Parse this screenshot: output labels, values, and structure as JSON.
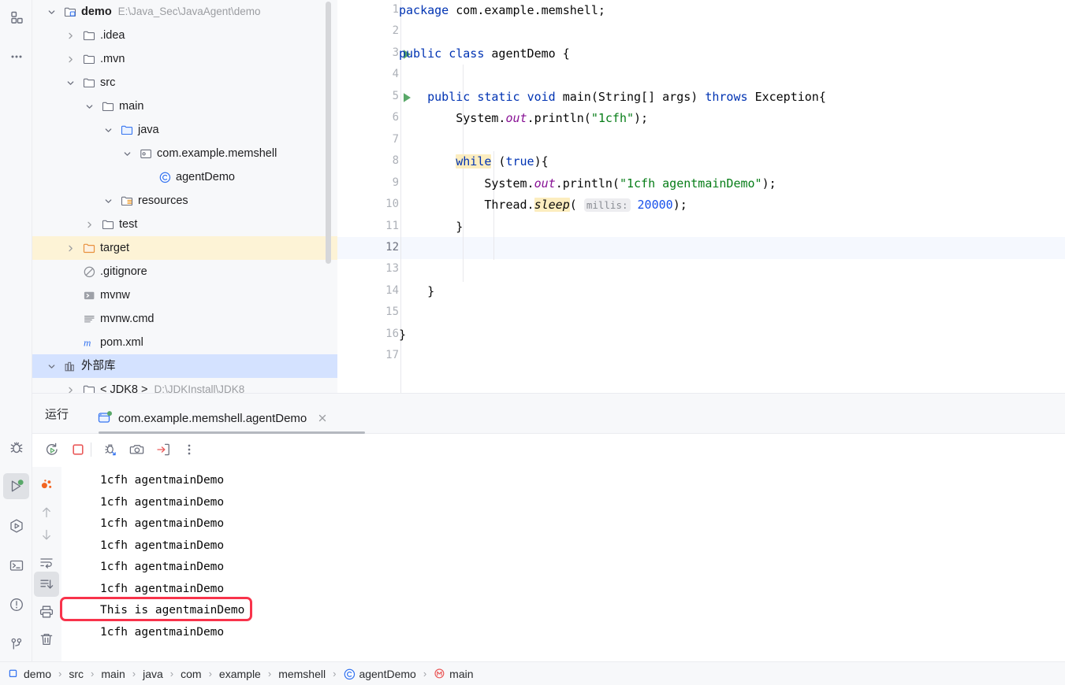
{
  "colors": {
    "accent_blue": "#0033b3",
    "string_green": "#067d17",
    "number_blue": "#1750eb",
    "field_purple": "#871094",
    "selection_blue": "#d4e2ff",
    "target_yellow": "#fdf3d6",
    "annotation_red": "#f8334b",
    "run_green": "#59a869",
    "stop_red": "#ea5b5b",
    "panel_grey": "#f7f8fa",
    "caret_row": "#f5f8fe"
  },
  "left_toolbar": {
    "top_items": [
      {
        "name": "project-icon",
        "label": "Project"
      },
      {
        "name": "more-icon",
        "label": "More tool windows"
      }
    ],
    "bottom_items": [
      {
        "name": "debug-icon",
        "label": "Debug",
        "selected": false
      },
      {
        "name": "run-icon",
        "label": "Run",
        "selected": true,
        "running": true
      },
      {
        "name": "services-icon",
        "label": "Services",
        "selected": false
      },
      {
        "name": "terminal-icon",
        "label": "Terminal",
        "selected": false
      },
      {
        "name": "problems-icon",
        "label": "Problems",
        "selected": false
      },
      {
        "name": "git-icon",
        "label": "Git",
        "selected": false
      }
    ]
  },
  "project_tree": {
    "rows": [
      {
        "label": "demo",
        "path": "E:\\Java_Sec\\JavaAgent\\demo",
        "icon": "module-folder-icon",
        "arrow": "down",
        "depth": 0,
        "bold": true,
        "highlight": "none"
      },
      {
        "label": ".idea",
        "path": "",
        "icon": "folder-icon",
        "arrow": "right",
        "depth": 1,
        "bold": false,
        "highlight": "none"
      },
      {
        "label": ".mvn",
        "path": "",
        "icon": "folder-icon",
        "arrow": "right",
        "depth": 1,
        "bold": false,
        "highlight": "none"
      },
      {
        "label": "src",
        "path": "",
        "icon": "folder-icon",
        "arrow": "down",
        "depth": 1,
        "bold": false,
        "highlight": "none"
      },
      {
        "label": "main",
        "path": "",
        "icon": "folder-icon",
        "arrow": "down",
        "depth": 2,
        "bold": false,
        "highlight": "none"
      },
      {
        "label": "java",
        "path": "",
        "icon": "source-folder-icon",
        "arrow": "down",
        "depth": 3,
        "bold": false,
        "highlight": "none"
      },
      {
        "label": "com.example.memshell",
        "path": "",
        "icon": "package-icon",
        "arrow": "down",
        "depth": 4,
        "bold": false,
        "highlight": "none"
      },
      {
        "label": "agentDemo",
        "path": "",
        "icon": "java-class-icon",
        "arrow": "none",
        "depth": 5,
        "bold": false,
        "highlight": "none"
      },
      {
        "label": "resources",
        "path": "",
        "icon": "resources-folder-icon",
        "arrow": "down",
        "depth": 3,
        "bold": false,
        "highlight": "none"
      },
      {
        "label": "test",
        "path": "",
        "icon": "folder-icon",
        "arrow": "right",
        "depth": 2,
        "bold": false,
        "highlight": "none"
      },
      {
        "label": "target",
        "path": "",
        "icon": "excluded-folder-icon",
        "arrow": "right",
        "depth": 1,
        "bold": false,
        "highlight": "target"
      },
      {
        "label": ".gitignore",
        "path": "",
        "icon": "gitignore-icon",
        "arrow": "none",
        "depth": 1,
        "bold": false,
        "highlight": "none"
      },
      {
        "label": "mvnw",
        "path": "",
        "icon": "shell-script-icon",
        "arrow": "none",
        "depth": 1,
        "bold": false,
        "highlight": "none"
      },
      {
        "label": "mvnw.cmd",
        "path": "",
        "icon": "text-file-icon",
        "arrow": "none",
        "depth": 1,
        "bold": false,
        "highlight": "none"
      },
      {
        "label": "pom.xml",
        "path": "",
        "icon": "maven-icon",
        "arrow": "none",
        "depth": 1,
        "bold": false,
        "highlight": "none"
      },
      {
        "label": "外部库",
        "path": "",
        "icon": "library-icon",
        "arrow": "down",
        "depth": 0,
        "bold": false,
        "highlight": "selected"
      },
      {
        "label": "< JDK8 >",
        "path": "D:\\JDKInstall\\JDK8",
        "icon": "folder-icon",
        "arrow": "right",
        "depth": 1,
        "bold": false,
        "highlight": "none"
      }
    ]
  },
  "editor": {
    "line_numbers": [
      1,
      2,
      3,
      4,
      5,
      6,
      7,
      8,
      9,
      10,
      11,
      12,
      13,
      14,
      15,
      16,
      17
    ],
    "run_marker_lines": [
      3,
      5
    ],
    "caret_line": 12,
    "lines": [
      {
        "n": 1,
        "text": "package com.example.memshell;"
      },
      {
        "n": 2,
        "text": ""
      },
      {
        "n": 3,
        "text": "public class agentDemo {"
      },
      {
        "n": 4,
        "text": ""
      },
      {
        "n": 5,
        "text": "    public static void main(String[] args) throws Exception{"
      },
      {
        "n": 6,
        "text": "        System.out.println(\"1cfh\");"
      },
      {
        "n": 7,
        "text": ""
      },
      {
        "n": 8,
        "text": "        while (true){"
      },
      {
        "n": 9,
        "text": "            System.out.println(\"1cfh agentmainDemo\");"
      },
      {
        "n": 10,
        "text": "            Thread.sleep( millis: 20000);"
      },
      {
        "n": 11,
        "text": "        }"
      },
      {
        "n": 12,
        "text": ""
      },
      {
        "n": 13,
        "text": ""
      },
      {
        "n": 14,
        "text": "    }"
      },
      {
        "n": 15,
        "text": ""
      },
      {
        "n": 16,
        "text": "}"
      },
      {
        "n": 17,
        "text": ""
      }
    ],
    "tokens": {
      "kw_package": "package",
      "pkg_name": "com.example.memshell;",
      "kw_public": "public",
      "kw_class": "class",
      "class_name": "agentDemo {",
      "kw_static": "static",
      "kw_void": "void",
      "method_main": "main(String[] args)",
      "kw_throws": "throws",
      "exception_sig": "Exception{",
      "system_out": "System.",
      "out_field": "out",
      "println": ".println(",
      "str_1cfh": "\"1cfh\"",
      "close_stmt": ");",
      "kw_while": "while",
      "kw_true": "true",
      "while_tail": "){",
      "str_agentmain": "\"1cfh agentmainDemo\"",
      "thread": "Thread.",
      "sleep": "sleep",
      "paren_open": "( ",
      "inlay_millis": "millis:",
      "num_20000": "20000",
      "brace_close": "}",
      "paren_close": ");"
    }
  },
  "run_window": {
    "title": "运行",
    "tab": {
      "label": "com.example.memshell.agentDemo",
      "icon": "console-tab-icon",
      "running": true,
      "close_label": "×"
    },
    "toolbar": [
      {
        "name": "rerun-button",
        "label": "Rerun"
      },
      {
        "name": "stop-button",
        "label": "Stop"
      },
      {
        "name": "attach-debugger-button",
        "label": "Attach debugger"
      },
      {
        "name": "screenshot-button",
        "label": "Capture memory snapshot"
      },
      {
        "name": "export-thread-dump-button",
        "label": "Export thread dump"
      },
      {
        "name": "more-options-button",
        "label": "More options"
      }
    ],
    "console_gutter": [
      {
        "name": "analyze-threads-icon",
        "label": "Analyze",
        "selected": false
      },
      {
        "name": "up-arrow-icon",
        "label": "Previous occurrence",
        "selected": false
      },
      {
        "name": "down-arrow-icon",
        "label": "Next occurrence",
        "selected": false
      },
      {
        "name": "soft-wrap-icon",
        "label": "Soft-wrap",
        "selected": false
      },
      {
        "name": "scroll-to-end-icon",
        "label": "Scroll to end",
        "selected": true
      },
      {
        "name": "print-icon",
        "label": "Print",
        "selected": false
      },
      {
        "name": "clear-all-icon",
        "label": "Clear all",
        "selected": false
      }
    ],
    "console_output": [
      "1cfh agentmainDemo",
      "1cfh agentmainDemo",
      "1cfh agentmainDemo",
      "1cfh agentmainDemo",
      "1cfh agentmainDemo",
      "1cfh agentmainDemo",
      "This is agentmainDemo",
      "1cfh agentmainDemo"
    ],
    "highlighted_output_index": 6
  },
  "breadcrumb": {
    "separator": "›",
    "items": [
      {
        "label": "demo",
        "icon": "module-icon"
      },
      {
        "label": "src",
        "icon": "none"
      },
      {
        "label": "main",
        "icon": "none"
      },
      {
        "label": "java",
        "icon": "none"
      },
      {
        "label": "com",
        "icon": "none"
      },
      {
        "label": "example",
        "icon": "none"
      },
      {
        "label": "memshell",
        "icon": "none"
      },
      {
        "label": "agentDemo",
        "icon": "java-class-icon"
      },
      {
        "label": "main",
        "icon": "method-icon"
      }
    ]
  }
}
